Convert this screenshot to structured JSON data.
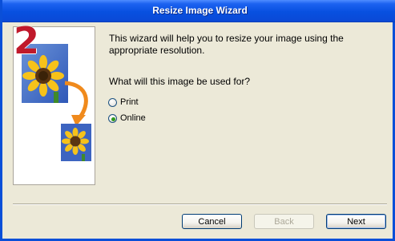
{
  "window": {
    "title": "Resize Image Wizard"
  },
  "illustration": {
    "step_number": "2"
  },
  "content": {
    "intro_text": "This wizard will help you to resize your image using the appropriate resolution.",
    "question": "What will this image be used for?",
    "options": [
      {
        "label": "Print",
        "selected": false
      },
      {
        "label": "Online",
        "selected": true
      }
    ]
  },
  "buttons": {
    "cancel": "Cancel",
    "back": "Back",
    "next": "Next"
  },
  "colors": {
    "titlebar": "#0850e0",
    "step_number": "#c0192b",
    "radio_selected": "#2f9a1c"
  }
}
